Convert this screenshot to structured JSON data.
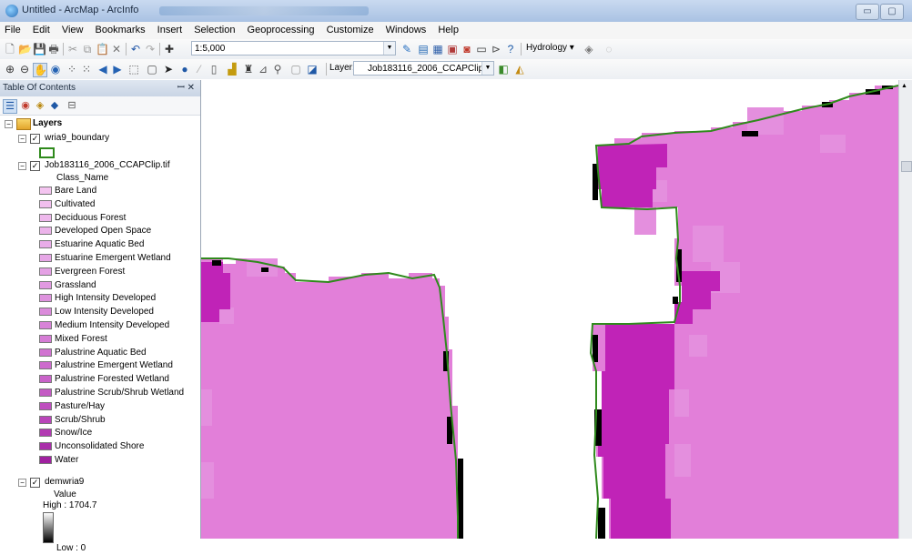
{
  "window": {
    "title": "Untitled - ArcMap - ArcInfo",
    "minimize_glyph": "▭",
    "maximize_glyph": "▢"
  },
  "menu": [
    "File",
    "Edit",
    "View",
    "Bookmarks",
    "Insert",
    "Selection",
    "Geoprocessing",
    "Customize",
    "Windows",
    "Help"
  ],
  "toolbar": {
    "scale": "1:5,000",
    "hydrology_label": "Hydrology ▾",
    "layer_label": "Layer:",
    "layer_value": "Job183116_2006_CCAPClip"
  },
  "toc": {
    "header": "Table Of Contents",
    "pin_glyph": "ꟷ ✕",
    "root": "Layers",
    "boundary_layer": "wria9_boundary",
    "ccap_layer": "Job183116_2006_CCAPClip.tif",
    "field": "Class_Name",
    "classes": [
      {
        "label": "Bare Land",
        "color": "#f4c4f0"
      },
      {
        "label": "Cultivated",
        "color": "#f1bfee"
      },
      {
        "label": "Deciduous Forest",
        "color": "#eeb8ec"
      },
      {
        "label": "Developed Open Space",
        "color": "#ecb3ea"
      },
      {
        "label": "Estuarine Aquatic Bed",
        "color": "#e9ace8"
      },
      {
        "label": "Estuarine Emergent Wetland",
        "color": "#e6a6e6"
      },
      {
        "label": "Evergreen Forest",
        "color": "#e4a0e4"
      },
      {
        "label": "Grassland",
        "color": "#e199e1"
      },
      {
        "label": "High Intensity Developed",
        "color": "#de92de"
      },
      {
        "label": "Low Intensity Developed",
        "color": "#db8bdb"
      },
      {
        "label": "Medium Intensity Developed",
        "color": "#d883d8"
      },
      {
        "label": "Mixed Forest",
        "color": "#d57cd5"
      },
      {
        "label": "Palustrine Aquatic Bed",
        "color": "#d173d1"
      },
      {
        "label": "Palustrine Emergent Wetland",
        "color": "#cd6bcd"
      },
      {
        "label": "Palustrine Forested Wetland",
        "color": "#c963c9"
      },
      {
        "label": "Palustrine Scrub/Shrub Wetland",
        "color": "#c45ac4"
      },
      {
        "label": "Pasture/Hay",
        "color": "#bf4fbf"
      },
      {
        "label": "Scrub/Shrub",
        "color": "#b945b9"
      },
      {
        "label": "Snow/Ice",
        "color": "#b23ab2"
      },
      {
        "label": "Unconsolidated Shore",
        "color": "#a92ea9"
      },
      {
        "label": "Water",
        "color": "#a020a0"
      }
    ],
    "dem_layer": "demwria9",
    "dem_field": "Value",
    "dem_high": "High : 1704.7",
    "dem_low": "Low : 0"
  },
  "colors": {
    "land": "#e27fd9",
    "land_light": "#e48fde",
    "wetland": "#c023b7",
    "nodata": "#000000",
    "boundary": "#2f8a1c"
  }
}
